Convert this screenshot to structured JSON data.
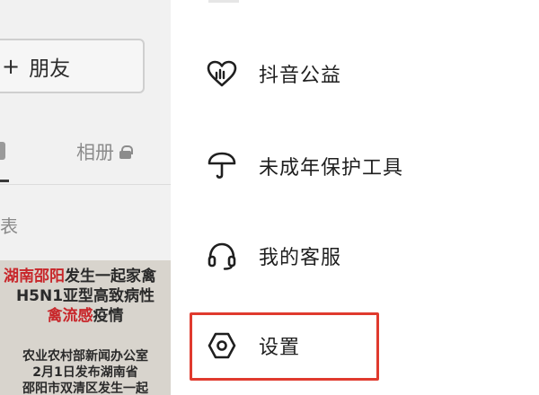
{
  "background_page": {
    "add_friend_label": "朋友",
    "add_friend_prefix": "+",
    "tab_album_label": "相册",
    "list_label": "表",
    "thumbnail": {
      "line1_red": "湖南邵阳",
      "line1_rest": "发生一起家禽",
      "line2": "H5N1亚型高致病性",
      "line3_red": "禽流感",
      "line3_rest": "疫情",
      "line4": "农业农村部新闻办公室",
      "line5": "2月1日发布湖南省",
      "line6": "邵阳市双清区发生一起"
    }
  },
  "menu": {
    "items": [
      {
        "label": "抖音公益",
        "icon": "charity-heart-icon"
      },
      {
        "label": "未成年保护工具",
        "icon": "umbrella-icon"
      },
      {
        "label": "我的客服",
        "icon": "headset-icon"
      },
      {
        "label": "设置",
        "icon": "settings-hexagon-icon"
      }
    ]
  },
  "colors": {
    "highlight": "#e03a2e",
    "accent_red": "#c8262a"
  }
}
